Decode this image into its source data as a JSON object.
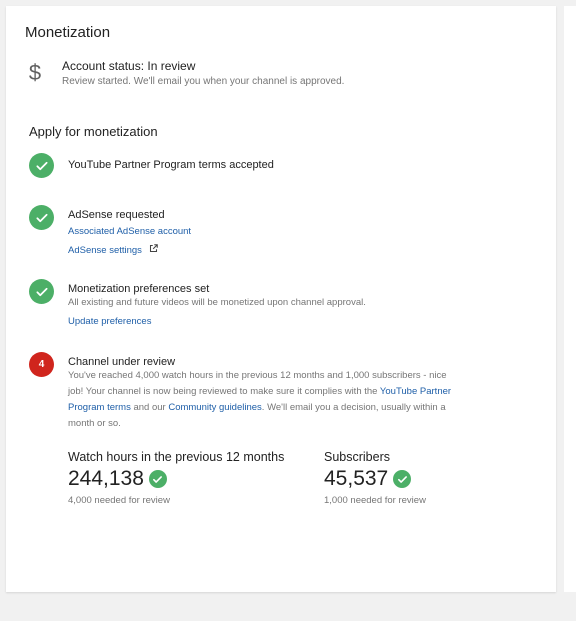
{
  "header": {
    "title": "Monetization"
  },
  "account": {
    "icon": "dollar-icon",
    "status": "Account status: In review",
    "message": "Review started. We'll email you when your channel is approved."
  },
  "apply": {
    "title": "Apply for monetization",
    "steps": [
      {
        "state": "done",
        "heading": "YouTube Partner Program terms accepted"
      },
      {
        "state": "done",
        "heading": "AdSense requested",
        "link1": "Associated AdSense account",
        "link2": "AdSense settings"
      },
      {
        "state": "done",
        "heading": "Monetization preferences set",
        "desc": "All existing and future videos will be monetized upon channel approval.",
        "link1": "Update preferences"
      },
      {
        "state": "current",
        "number": "4",
        "heading": "Channel under review",
        "desc_part1": "You've reached 4,000 watch hours in the previous 12 months and 1,000 subscribers - nice job! Your channel is now being reviewed to make sure it complies with the ",
        "link_terms": "YouTube Partner Program terms",
        "desc_part2": " and our ",
        "link_guidelines": "Community guidelines",
        "desc_part3": ". We'll email you a decision, usually within a month or so."
      }
    ]
  },
  "stats": {
    "watch_hours": {
      "label": "Watch hours in the previous 12 months",
      "value": "244,138",
      "note": "4,000 needed for review"
    },
    "subscribers": {
      "label": "Subscribers",
      "value": "45,537",
      "note": "1,000 needed for review"
    }
  },
  "colors": {
    "success": "#4caf67",
    "alert": "#d0251d",
    "link": "#1f5fa8"
  }
}
